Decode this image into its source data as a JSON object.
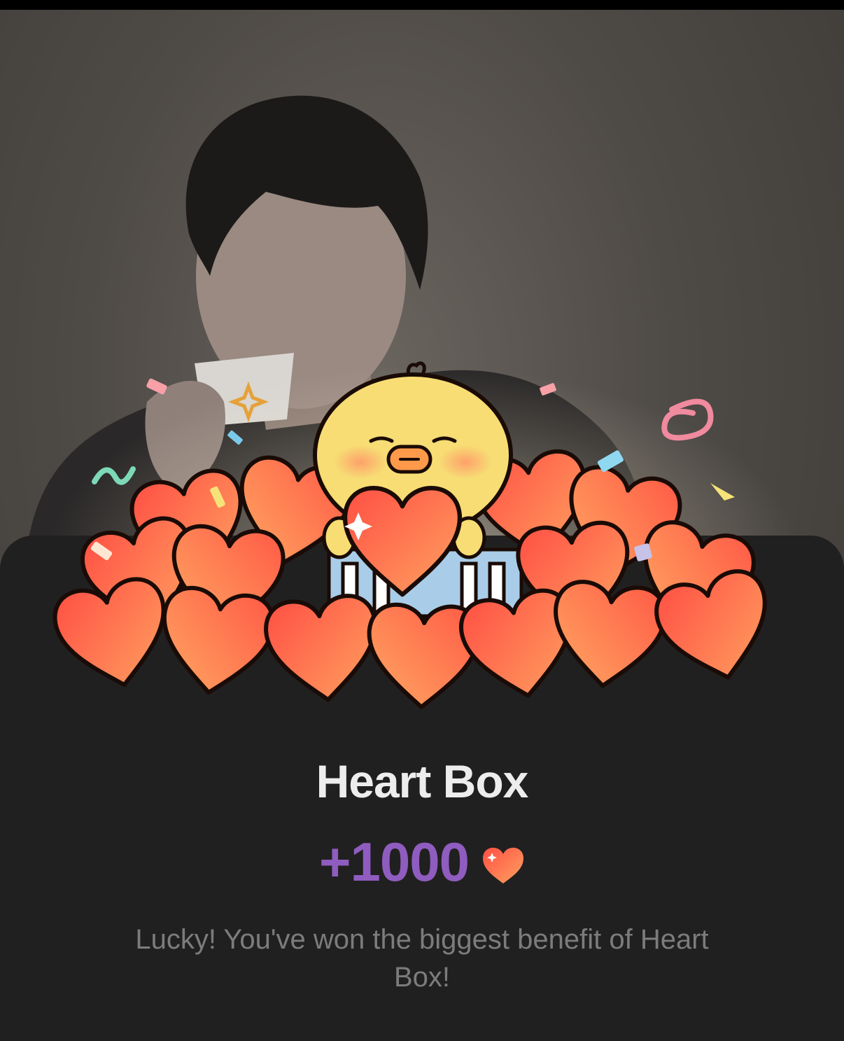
{
  "reward": {
    "title": "Heart Box",
    "amount": "+1000",
    "currency_icon": "heart-icon",
    "message": "Lucky! You've won the biggest benefit of Heart Box!"
  },
  "colors": {
    "sheet_background": "#202020",
    "title_text": "#ededed",
    "amount_text": "#8f5cbf",
    "message_text": "#7c7c7c",
    "heart_light": "#ffa260",
    "heart_dark": "#ff4f44",
    "chick_yellow": "#f7dd74"
  }
}
